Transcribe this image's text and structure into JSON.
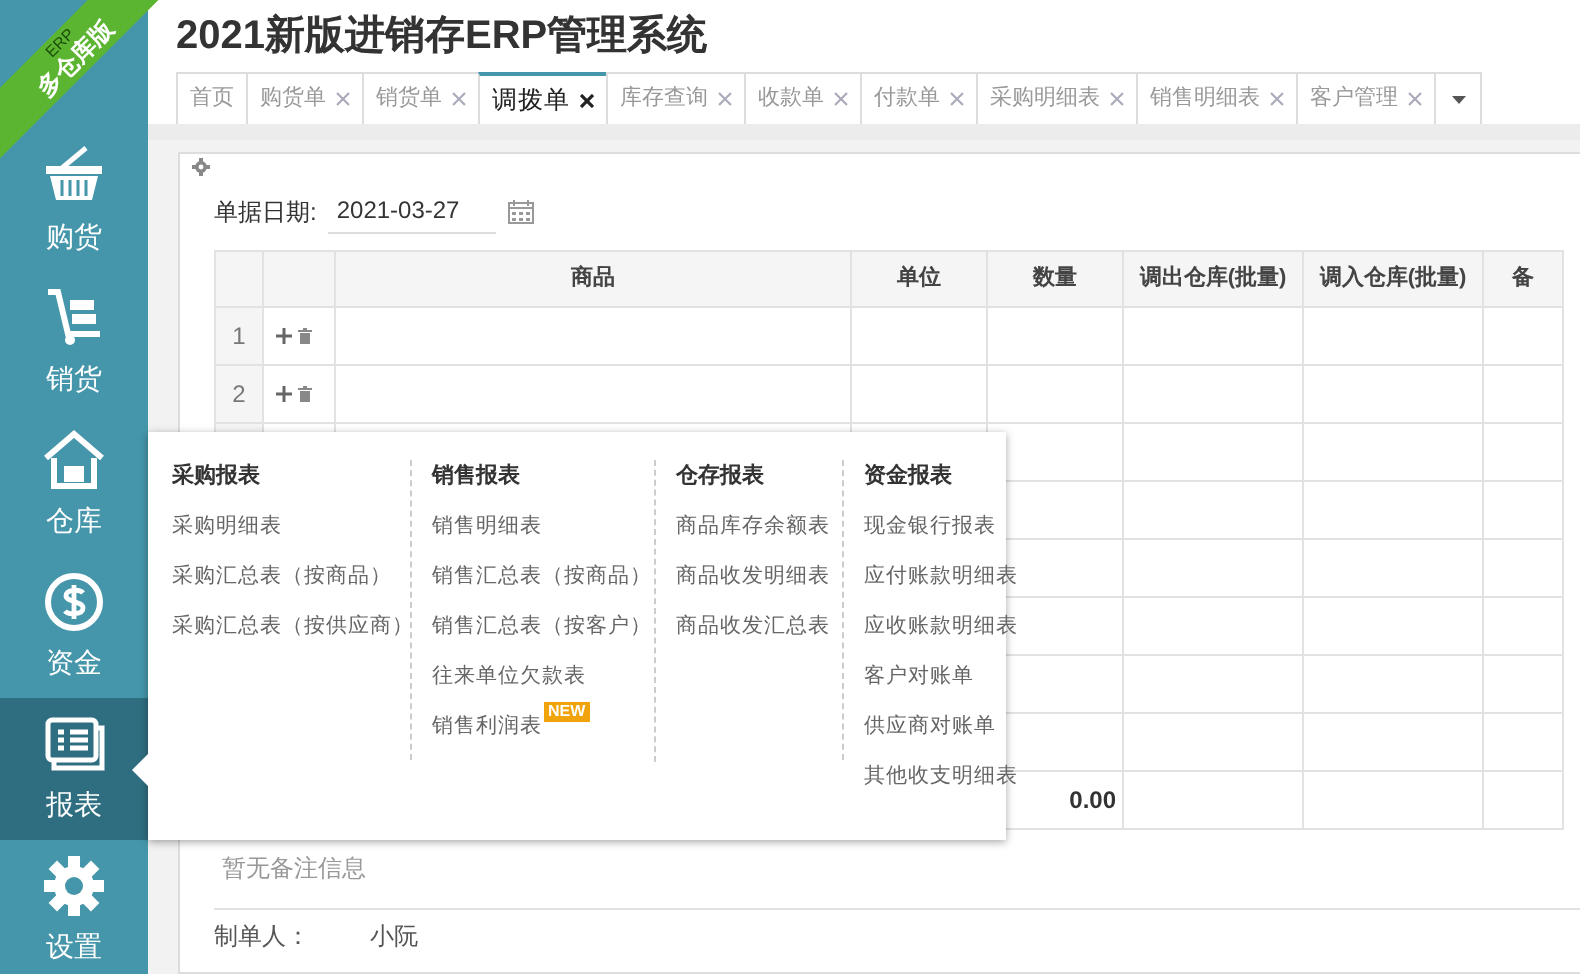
{
  "ribbon": {
    "small": "ERP",
    "text": "多仓库版"
  },
  "title": "2021新版进销存ERP管理系统",
  "sidebar": {
    "items": [
      {
        "label": "购货",
        "kind": "basket",
        "selected": false
      },
      {
        "label": "销货",
        "kind": "truck",
        "selected": false
      },
      {
        "label": "仓库",
        "kind": "house",
        "selected": false
      },
      {
        "label": "资金",
        "kind": "dollar",
        "selected": false
      },
      {
        "label": "报表",
        "kind": "report",
        "selected": true
      },
      {
        "label": "设置",
        "kind": "gear",
        "selected": false
      }
    ]
  },
  "tabs": [
    {
      "label": "首页",
      "closable": false,
      "selected": false
    },
    {
      "label": "购货单",
      "closable": true,
      "selected": false
    },
    {
      "label": "销货单",
      "closable": true,
      "selected": false
    },
    {
      "label": "调拨单",
      "closable": true,
      "selected": true
    },
    {
      "label": "库存查询",
      "closable": true,
      "selected": false
    },
    {
      "label": "收款单",
      "closable": true,
      "selected": false
    },
    {
      "label": "付款单",
      "closable": true,
      "selected": false
    },
    {
      "label": "采购明细表",
      "closable": true,
      "selected": false
    },
    {
      "label": "销售明细表",
      "closable": true,
      "selected": false
    },
    {
      "label": "客户管理",
      "closable": true,
      "selected": false
    }
  ],
  "form": {
    "date_label": "单据日期:",
    "date_value": "2021-03-27"
  },
  "table": {
    "columns": [
      "商品",
      "单位",
      "数量",
      "调出仓库(批量)",
      "调入仓库(批量)",
      "备"
    ],
    "rows": [
      {
        "number": "1"
      },
      {
        "number": "2"
      }
    ],
    "totals": {
      "quantity": "0.00"
    }
  },
  "remark": "暂无备注信息",
  "footer": {
    "label": "制单人：",
    "value": "小阮"
  },
  "menu": {
    "columns": [
      {
        "heading": "采购报表",
        "items": [
          {
            "label": "采购明细表"
          },
          {
            "label": "采购汇总表（按商品）"
          },
          {
            "label": "采购汇总表（按供应商）"
          }
        ]
      },
      {
        "heading": "销售报表",
        "items": [
          {
            "label": "销售明细表"
          },
          {
            "label": "销售汇总表（按商品）"
          },
          {
            "label": "销售汇总表（按客户）"
          },
          {
            "label": "往来单位欠款表"
          },
          {
            "label": "销售利润表",
            "badge": "NEW"
          }
        ]
      },
      {
        "heading": "仓存报表",
        "items": [
          {
            "label": "商品库存余额表"
          },
          {
            "label": "商品收发明细表"
          },
          {
            "label": "商品收发汇总表"
          }
        ]
      },
      {
        "heading": "资金报表",
        "items": [
          {
            "label": "现金银行报表"
          },
          {
            "label": "应付账款明细表"
          },
          {
            "label": "应收账款明细表"
          },
          {
            "label": "客户对账单"
          },
          {
            "label": "供应商对账单"
          },
          {
            "label": "其他收支明细表"
          }
        ]
      }
    ]
  }
}
